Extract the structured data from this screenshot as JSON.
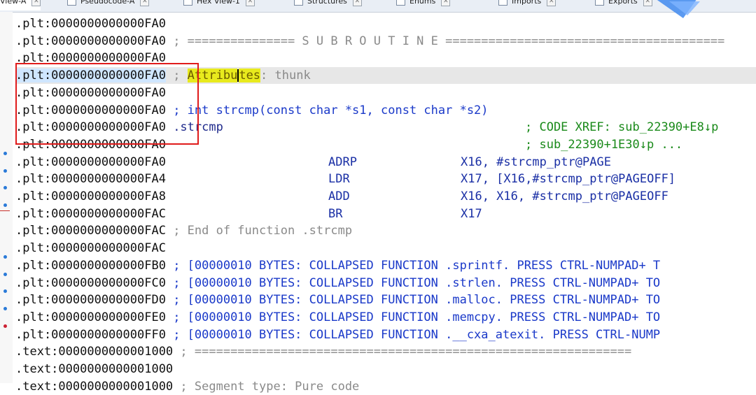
{
  "tabs": [
    {
      "label": "View-A",
      "active": true
    },
    {
      "label": "Pseudocode-A"
    },
    {
      "label": "Hex View-1"
    },
    {
      "label": "Structures"
    },
    {
      "label": "Enums"
    },
    {
      "label": "Imports"
    },
    {
      "label": "Exports"
    }
  ],
  "lines": [
    {
      "addr": ".plt:0000000000000FA0"
    },
    {
      "addr": ".plt:0000000000000FA0",
      "comment": "; =============== S U B R O U T I N E ======================================="
    },
    {
      "addr": ".plt:0000000000000FA0"
    },
    {
      "addr": ".plt:0000000000000FA0",
      "pre": "; ",
      "attr": "Attribu",
      "attr2": "tes",
      "post": ": thunk"
    },
    {
      "addr": ".plt:0000000000000FA0"
    },
    {
      "addr": ".plt:0000000000000FA0",
      "proto": "; int strcmp(const char *s1, const char *s2)"
    },
    {
      "addr": ".plt:0000000000000FA0",
      "label": ".strcmp",
      "xref": "; CODE XREF: sub_22390+E8↓p"
    },
    {
      "addr": ".plt:0000000000000FA0",
      "xref": "; sub_22390+1E30↓p ..."
    },
    {
      "addr": ".plt:0000000000000FA0",
      "mnem": "ADRP",
      "ops": "X16, #strcmp_ptr@PAGE"
    },
    {
      "addr": ".plt:0000000000000FA4",
      "mnem": "LDR",
      "ops": "X17, [X16,#strcmp_ptr@PAGEOFF]"
    },
    {
      "addr": ".plt:0000000000000FA8",
      "mnem": "ADD",
      "ops": "X16, X16, #strcmp_ptr@PAGEOFF"
    },
    {
      "addr": ".plt:0000000000000FAC",
      "mnem": "BR",
      "ops": "X17"
    },
    {
      "addr": ".plt:0000000000000FAC",
      "comment": "; End of function .strcmp"
    },
    {
      "addr": ".plt:0000000000000FAC"
    },
    {
      "addr": ".plt:0000000000000FB0",
      "collapsed": "; [00000010 BYTES: COLLAPSED FUNCTION .sprintf. PRESS CTRL-NUMPAD+ T"
    },
    {
      "addr": ".plt:0000000000000FC0",
      "collapsed": "; [00000010 BYTES: COLLAPSED FUNCTION .strlen. PRESS CTRL-NUMPAD+ TO"
    },
    {
      "addr": ".plt:0000000000000FD0",
      "collapsed": "; [00000010 BYTES: COLLAPSED FUNCTION .malloc. PRESS CTRL-NUMPAD+ TO"
    },
    {
      "addr": ".plt:0000000000000FE0",
      "collapsed": "; [00000010 BYTES: COLLAPSED FUNCTION .memcpy. PRESS CTRL-NUMPAD+ TO"
    },
    {
      "addr": ".plt:0000000000000FF0",
      "collapsed": "; [00000010 BYTES: COLLAPSED FUNCTION .__cxa_atexit. PRESS CTRL-NUMP"
    },
    {
      "addr": ".text:0000000000001000",
      "comment": "; ============================================================="
    },
    {
      "addr": ".text:0000000000001000"
    },
    {
      "addr": ".text:0000000000001000",
      "comment": "; Segment type: Pure code"
    }
  ],
  "colors": {
    "highlight": "#e7e7e7",
    "annotation_box": "#e01b1b",
    "attribute_bg": "#e8ea1d"
  }
}
